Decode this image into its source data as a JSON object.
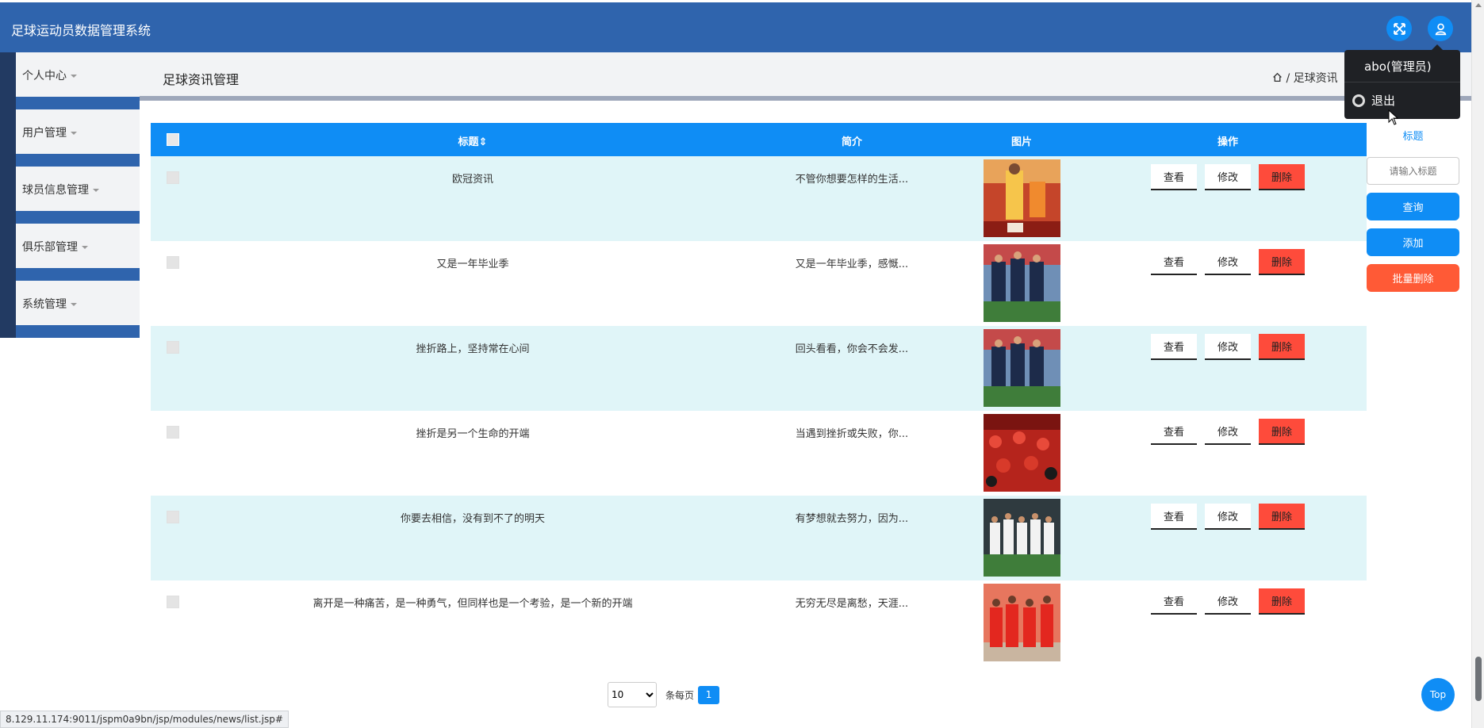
{
  "app": {
    "title": "足球运动员数据管理系统"
  },
  "sidebar": {
    "items": [
      {
        "label": "个人中心"
      },
      {
        "label": "用户管理"
      },
      {
        "label": "球员信息管理"
      },
      {
        "label": "俱乐部管理"
      },
      {
        "label": "系统管理"
      }
    ]
  },
  "page": {
    "title": "足球资讯管理",
    "breadcrumb": "/ 足球资讯"
  },
  "table": {
    "headers": {
      "title": "标题⇕",
      "intro": "简介",
      "image": "图片",
      "actions": "操作"
    },
    "rows": [
      {
        "title": "欧冠资讯",
        "intro": "不管你想要怎样的生活...",
        "view": "查看",
        "edit": "修改",
        "delete": "删除",
        "img": "orange-team"
      },
      {
        "title": "又是一年毕业季",
        "intro": "又是一年毕业季，感慨...",
        "view": "查看",
        "edit": "修改",
        "delete": "删除",
        "img": "blue-players"
      },
      {
        "title": "挫折路上，坚持常在心间",
        "intro": "回头看看，你会不会发...",
        "view": "查看",
        "edit": "修改",
        "delete": "删除",
        "img": "blue-players"
      },
      {
        "title": "挫折是另一个生命的开端",
        "intro": "当遇到挫折或失败，你...",
        "view": "查看",
        "edit": "修改",
        "delete": "删除",
        "img": "red-crowd"
      },
      {
        "title": "你要去相信，没有到不了的明天",
        "intro": "有梦想就去努力，因为...",
        "view": "查看",
        "edit": "修改",
        "delete": "删除",
        "img": "white-team"
      },
      {
        "title": "离开是一种痛苦，是一种勇气，但同样也是一个考验，是一个新的开端",
        "intro": "无穷无尽是离愁，天涯...",
        "view": "查看",
        "edit": "修改",
        "delete": "删除",
        "img": "red-team"
      }
    ]
  },
  "search": {
    "label": "标题",
    "placeholder": "请输入标题",
    "search_button": "查询",
    "add_button": "添加",
    "bulk_delete_button": "批量删除"
  },
  "pagination": {
    "page_size": "10",
    "page_size_options": [
      "10"
    ],
    "per_page_label": "条每页",
    "current_page": "1"
  },
  "user_menu": {
    "name": "abo(管理员)",
    "logout": "退出"
  },
  "top_button": "Top",
  "status_bar": {
    "url": "8.129.11.174:9011/jspm0a9bn/jsp/modules/news/list.jsp#"
  },
  "colors": {
    "header": "#2f64ad",
    "primary": "#0f8df5",
    "danger": "#fe4b3b",
    "row_odd": "#e0f5f8"
  },
  "icons": {
    "fullscreen": "expand-icon",
    "user": "user-icon",
    "home": "home-icon",
    "logout": "logout-icon"
  }
}
